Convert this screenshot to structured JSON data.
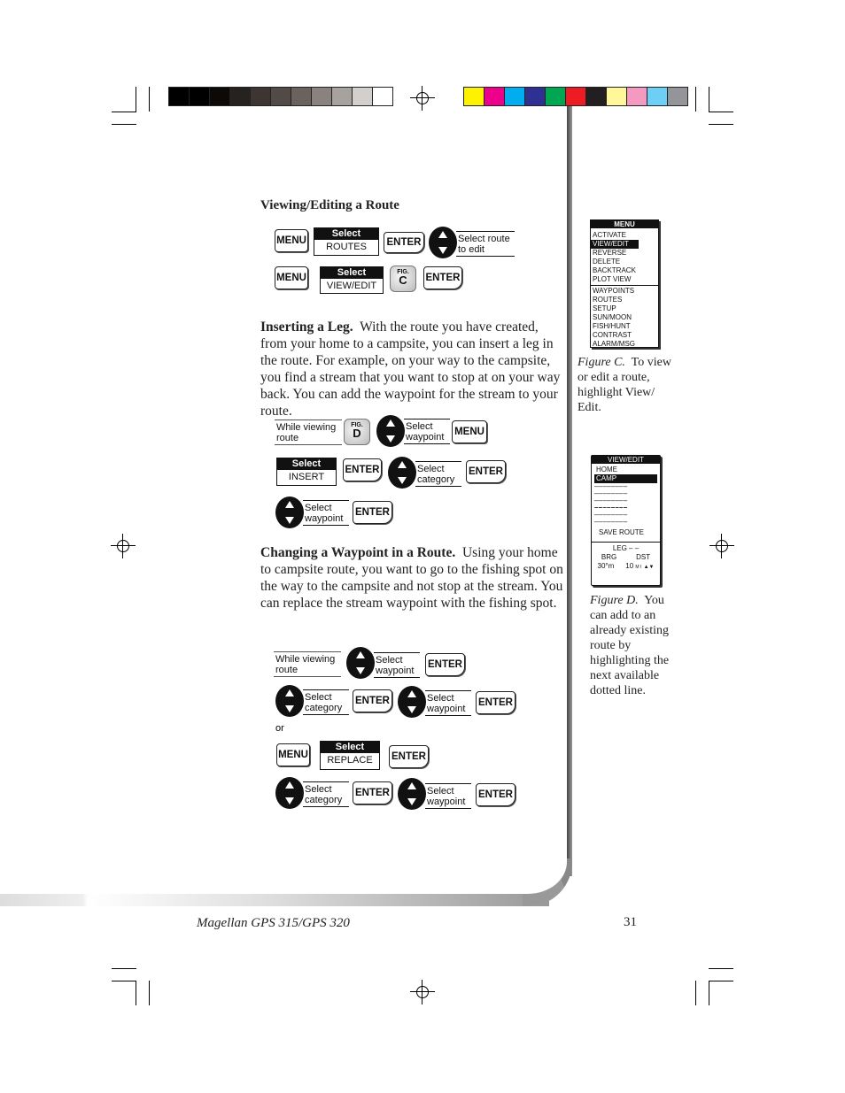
{
  "colors": {
    "gray_bar": [
      "#000000",
      "#000000",
      "#0d0906",
      "#262220",
      "#3c3532",
      "#524a46",
      "#6b625e",
      "#8a827e",
      "#a8a29e",
      "#d3cfcd",
      "#ffffff"
    ],
    "color_bar": [
      "#fff200",
      "#ec008c",
      "#00aeef",
      "#2e3192",
      "#00a651",
      "#ed1c24",
      "#231f20",
      "#fff799",
      "#f49ac1",
      "#6dcff6",
      "#939598"
    ]
  },
  "section1": {
    "heading": "Viewing/Editing a Route",
    "row1": {
      "menu": "MENU",
      "select_top": "Select",
      "select_bottom": "ROUTES",
      "enter": "ENTER",
      "arrow_label_1": "Select route",
      "arrow_label_2": "to edit"
    },
    "row2": {
      "menu": "MENU",
      "select_top": "Select",
      "select_bottom": "VIEW/EDIT",
      "fig_small": "FIG.",
      "fig_letter": "C",
      "enter": "ENTER"
    }
  },
  "section2": {
    "heading": "Inserting a Leg.",
    "body": "With the route you have created, from your home to a campsite, you can insert a leg in the route.  For example, on your way to the campsite, you find a stream that you want to stop at on your way back.  You can add the waypoint for the stream to your route.",
    "row1": {
      "label_1": "While viewing",
      "label_2": "route",
      "fig_small": "FIG.",
      "fig_letter": "D",
      "arrow_label_1": "Select",
      "arrow_label_2": "waypoint",
      "menu": "MENU"
    },
    "row2": {
      "select_top": "Select",
      "select_bottom": "INSERT",
      "enter": "ENTER",
      "arrow_label_1": "Select",
      "arrow_label_2": "category",
      "enter2": "ENTER"
    },
    "row3": {
      "arrow_label_1": "Select",
      "arrow_label_2": "waypoint",
      "enter": "ENTER"
    }
  },
  "section3": {
    "heading": "Changing a Waypoint in a Route.",
    "body": "Using your home to campsite route, you want to go to the fishing spot on the way to the campsite and not stop at the stream.  You can replace the stream waypoint with the fishing spot.",
    "row1": {
      "label_1": "While viewing",
      "label_2": "route",
      "arrow_label_1": "Select",
      "arrow_label_2": "waypoint",
      "enter": "ENTER"
    },
    "row2": {
      "arrow_label_1": "Select",
      "arrow_label_2": "category",
      "enter": "ENTER",
      "arrow2_label_1": "Select",
      "arrow2_label_2": "waypoint",
      "enter2": "ENTER"
    },
    "or": "or",
    "row3": {
      "menu": "MENU",
      "select_top": "Select",
      "select_bottom": "REPLACE",
      "enter": "ENTER"
    },
    "row4": {
      "arrow_label_1": "Select",
      "arrow_label_2": "category",
      "enter": "ENTER",
      "arrow2_label_1": "Select",
      "arrow2_label_2": "waypoint",
      "enter2": "ENTER"
    }
  },
  "figure_c": {
    "title": "MENU",
    "group1": [
      "ACTIVATE",
      "VIEW/EDIT",
      "REVERSE",
      "DELETE",
      "BACKTRACK",
      "PLOT VIEW"
    ],
    "highlighted": "VIEW/EDIT",
    "group2": [
      "WAYPOINTS",
      "ROUTES",
      "SETUP",
      "SUN/MOON",
      "FISH/HUNT",
      "CONTRAST",
      "ALARM/MSG"
    ],
    "caption_label": "Figure C.",
    "caption": "To view or edit a route, highlight View/ Edit."
  },
  "figure_d": {
    "title": "VIEW/EDIT",
    "items": [
      "HOME",
      "CAMP"
    ],
    "highlighted": "CAMP",
    "dashes": "– – – – – – – –",
    "save": "SAVE ROUTE",
    "leg": "LEG  – –",
    "brg": "BRG",
    "dst": "DST",
    "brg_val": "30°m",
    "dst_val": "10",
    "dst_unit": "M I",
    "caption_label": "Figure D.",
    "caption": "You can add to an already existing route by highlighting the next available dotted line."
  },
  "footer": {
    "title": "Magellan GPS 315/GPS 320",
    "page": "31"
  }
}
